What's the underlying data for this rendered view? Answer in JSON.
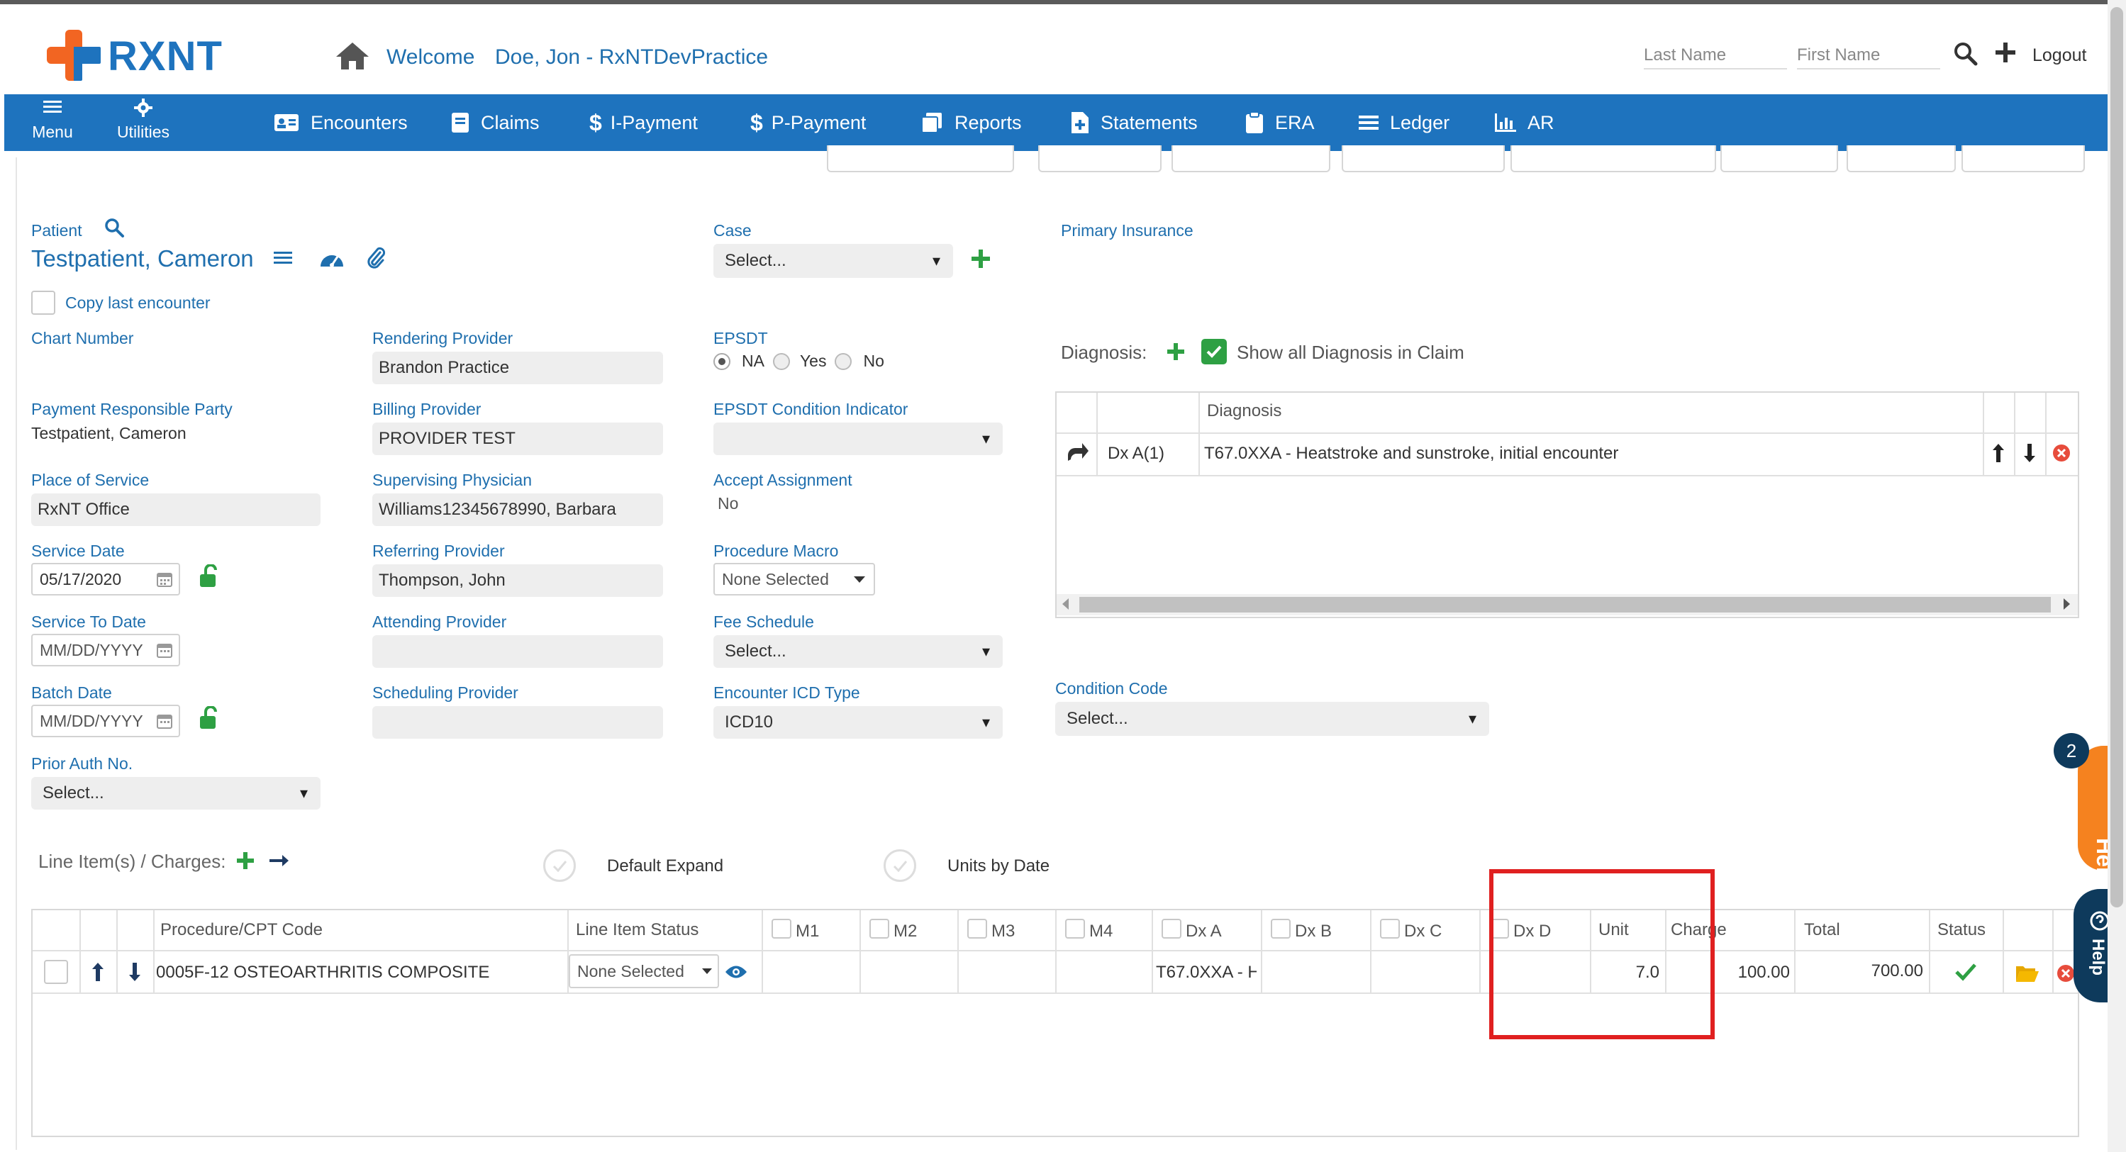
{
  "header": {
    "logo_text": "RXNT",
    "welcome_label": "Welcome",
    "user_practice": "Doe, Jon - RxNTDevPractice",
    "last_name_placeholder": "Last Name",
    "first_name_placeholder": "First Name",
    "logout_label": "Logout"
  },
  "nav": {
    "menu_label": "Menu",
    "utilities_label": "Utilities",
    "items": [
      {
        "label": "Encounters",
        "icon": "id-card-icon"
      },
      {
        "label": "Claims",
        "icon": "document-icon"
      },
      {
        "label": "I-Payment",
        "icon": "dollar-icon"
      },
      {
        "label": "P-Payment",
        "icon": "dollar-icon"
      },
      {
        "label": "Reports",
        "icon": "copy-icon"
      },
      {
        "label": "Statements",
        "icon": "file-plus-icon"
      },
      {
        "label": "ERA",
        "icon": "clipboard-icon"
      },
      {
        "label": "Ledger",
        "icon": "list-icon"
      },
      {
        "label": "AR",
        "icon": "bar-chart-icon"
      }
    ]
  },
  "patient": {
    "label": "Patient",
    "name": "Testpatient, Cameron",
    "copy_last_encounter": "Copy last encounter",
    "chart_number_label": "Chart Number",
    "payment_party_label": "Payment Responsible Party",
    "payment_party_value": "Testpatient, Cameron",
    "place_of_service_label": "Place of Service",
    "place_of_service_value": "RxNT Office",
    "service_date_label": "Service Date",
    "service_date_value": "05/17/2020",
    "service_to_date_label": "Service To Date",
    "date_placeholder": "MM/DD/YYYY",
    "batch_date_label": "Batch Date",
    "prior_auth_label": "Prior Auth No.",
    "prior_auth_value": "Select..."
  },
  "providers": {
    "rendering_label": "Rendering Provider",
    "rendering_value": "Brandon Practice",
    "billing_label": "Billing Provider",
    "billing_value": "PROVIDER TEST",
    "supervising_label": "Supervising Physician",
    "supervising_value": "Williams12345678990, Barbara",
    "referring_label": "Referring Provider",
    "referring_value": "Thompson, John",
    "attending_label": "Attending Provider",
    "scheduling_label": "Scheduling Provider"
  },
  "case_col": {
    "case_label": "Case",
    "case_value": "Select...",
    "epsdt_label": "EPSDT",
    "epsdt_options": [
      "NA",
      "Yes",
      "No"
    ],
    "epsdt_condition_label": "EPSDT Condition Indicator",
    "accept_assignment_label": "Accept Assignment",
    "accept_assignment_value": "No",
    "procedure_macro_label": "Procedure Macro",
    "procedure_macro_value": "None Selected",
    "fee_schedule_label": "Fee Schedule",
    "fee_schedule_value": "Select...",
    "icd_type_label": "Encounter ICD Type",
    "icd_type_value": "ICD10"
  },
  "insurance": {
    "primary_label": "Primary Insurance",
    "diagnosis_label": "Diagnosis:",
    "show_all_label": "Show all Diagnosis in Claim",
    "diag_header": "Diagnosis",
    "diag_rows": [
      {
        "code_ref": "Dx A(1)",
        "description": "T67.0XXA - Heatstroke and sunstroke, initial encounter"
      }
    ],
    "condition_code_label": "Condition Code",
    "condition_code_value": "Select..."
  },
  "line_items": {
    "title": "Line Item(s) / Charges:",
    "default_expand": "Default Expand",
    "units_by_date": "Units by Date",
    "columns": [
      "Procedure/CPT Code",
      "Line Item Status",
      "M1",
      "M2",
      "M3",
      "M4",
      "Dx A",
      "Dx B",
      "Dx C",
      "Dx D",
      "Unit",
      "Charge",
      "Total",
      "Status"
    ],
    "rows": [
      {
        "procedure": "0005F-12 OSTEOARTHRITIS COMPOSITE",
        "status": "None Selected",
        "dx_a": "T67.0XXA - H",
        "unit": "7.0",
        "charge": "100.00",
        "total": "700.00"
      }
    ]
  },
  "help": {
    "badge_count": "2",
    "help_label": "Help",
    "help2_label": "Help"
  },
  "colors": {
    "nav_blue": "#1e73be",
    "logo_orange": "#f26522",
    "green": "#2ea043",
    "highlight_red": "#e02020"
  }
}
